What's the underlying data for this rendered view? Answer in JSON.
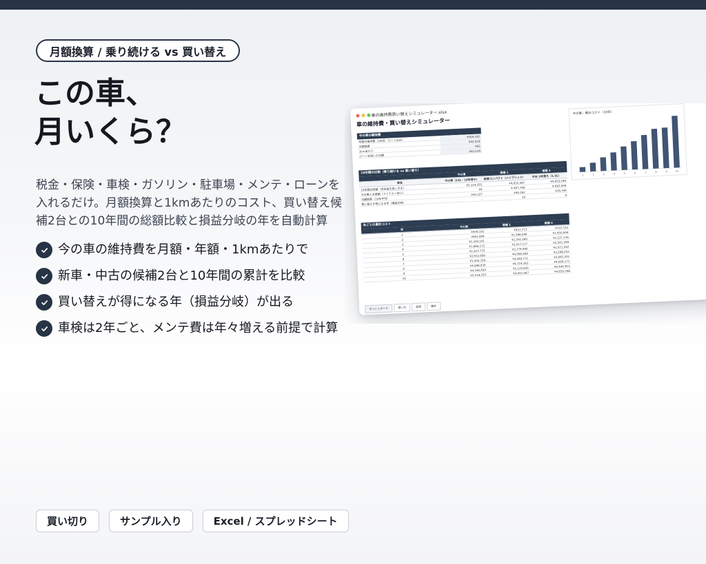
{
  "pill": {
    "label": "月額換算 / 乗り続ける vs 買い替え"
  },
  "headline": {
    "line1": "この車、",
    "line2": "月いくら？"
  },
  "description": "税金・保険・車検・ガソリン・駐車場・メンテ・ローンを入れるだけ。月額換算と1kmあたりのコスト、買い替え候補2台との10年間の総額比較と損益分岐の年を自動計算",
  "features": [
    {
      "icon": "check-circle-icon",
      "text": "今の車の維持費を月額・年額・1kmあたりで"
    },
    {
      "icon": "check-circle-icon",
      "text": "新車・中古の候補2台と10年間の累計を比較"
    },
    {
      "icon": "check-circle-icon",
      "text": "買い替えが得になる年（損益分岐）が出る"
    },
    {
      "icon": "check-circle-icon",
      "text": "車検は2年ごと、メンテ費は年々増える前提で計算"
    }
  ],
  "tags": [
    "買い切り",
    "サンプル入り",
    "Excel / スプレッドシート"
  ],
  "colors": {
    "accent": "#263445",
    "bar": "#3f5573",
    "dot_red": "#ec6a5e",
    "dot_yellow": "#f4bf4f",
    "dot_green": "#61c554"
  },
  "spreadsheet": {
    "file_name": "車の維持費買い替えシミュレーター.xlsx",
    "title": "車の維持費・買い替えシミュレーター",
    "current": {
      "header": "今の車の維持費",
      "rows": [
        {
          "label": "年間の維持費（1年目、ローン込み）",
          "value": "¥504,192"
        },
        {
          "label": "月額換算",
          "value": "¥42,016"
        },
        {
          "label": "1kmあたり",
          "value": "¥63"
        },
        {
          "label": "ローンを除いた月額",
          "value": "¥42,016"
        }
      ]
    },
    "compare": {
      "header": "10年間の比較（乗り続ける vs 買い替え）",
      "columns": [
        "",
        "今の車",
        "候補 1",
        "候補 2"
      ],
      "sub": [
        "車名",
        "今の車（13L・10年落ち）",
        "新車コンパクト（ハイブリッド）",
        "中古 3年落ち（1.5L）"
      ],
      "rows": [
        [
          "10年間の総額（売却益を差し引き）",
          "¥5,319,255",
          "¥4,831,467",
          "¥4,655,296"
        ],
        [
          "今の車との差額（マイナス＝安い）",
          "¥0",
          "¥-487,788",
          "¥-663,959"
        ],
        [
          "月額換算（10年平均）",
          "¥44,327",
          "¥40,262",
          "¥38,794"
        ],
        [
          "買い替えが得になる年（損益分岐）",
          "-",
          "10",
          "9"
        ]
      ]
    },
    "yearly": {
      "header": "年ごとの累計コスト",
      "columns": [
        "年",
        "今の車",
        "候補 1",
        "候補 2"
      ],
      "rows": [
        [
          "1",
          "¥504,192",
          "¥937,773",
          "¥707,722"
        ],
        [
          "2",
          "¥901,884",
          "¥1,588,046",
          "¥1,450,944"
        ],
        [
          "3",
          "¥1,410,101",
          "¥2,341,069",
          "¥2,127,116"
        ],
        [
          "4",
          "¥1,866,172",
          "¥3,017,117",
          "¥2,541,289"
        ],
        [
          "5",
          "¥2,427,775",
          "¥3,779,490",
          "¥2,871,452"
        ],
        [
          "6",
          "¥2,912,889",
          "¥4,006,569",
          "¥3,288,203"
        ],
        [
          "7",
          "¥3,505,358",
          "¥4,440,711",
          "¥3,642,201"
        ],
        [
          "8",
          "¥4,088,930",
          "¥4,719,262",
          "¥4,064,171"
        ],
        [
          "9",
          "¥4,158,454",
          "¥5,122,605",
          "¥4,444,910"
        ],
        [
          "10",
          "¥5,319,255",
          "¥4,831,467",
          "¥4,655,296"
        ]
      ]
    },
    "tabs": [
      "ダッシュボード",
      "使い方",
      "設定",
      "集計"
    ],
    "chart": {
      "title": "今の車：累計コスト（10年）",
      "chart_data": {
        "type": "bar",
        "categories": [
          "1",
          "2",
          "3",
          "4",
          "5",
          "6",
          "7",
          "8",
          "9",
          "10"
        ],
        "values": [
          504192,
          901884,
          1410101,
          1866172,
          2427775,
          2912889,
          3505358,
          4088930,
          4158454,
          5319255
        ],
        "ylim": [
          0,
          5500000
        ]
      }
    }
  }
}
